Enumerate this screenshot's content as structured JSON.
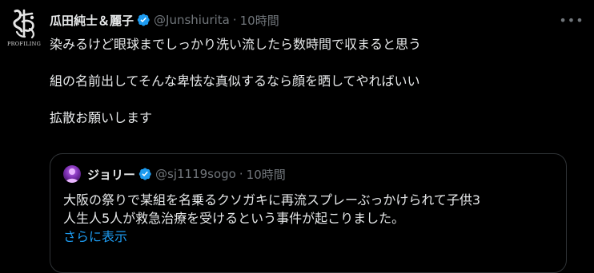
{
  "tweet": {
    "display_name": "瓜田純士＆麗子",
    "handle": "@Junshiurita",
    "separator": "·",
    "time": "10時間",
    "avatar_brand": "PROFILING",
    "lines": [
      "染みるけど眼球までしっかり洗い流したら数時間で収まると思う",
      "",
      "組の名前出してそんな卑怯な真似するなら顔を晒してやればいい",
      "",
      "拡散お願いします"
    ]
  },
  "quote": {
    "display_name": "ジョリー",
    "handle": "@sj1119sogo",
    "separator": "·",
    "time": "10時間",
    "text_lines": [
      "大阪の祭りで某組を名乗るクソガキに再流スプレーぶっかけられて子供3",
      "人生人5人が救急治療を受けるという事件が起こりました。"
    ],
    "show_more": "さらに表示"
  },
  "icons": {
    "verified": "verified-badge-icon",
    "more": "more-options-icon"
  },
  "colors": {
    "background": "#000000",
    "text": "#e7e9ea",
    "muted": "#71767b",
    "link": "#1d9bf0",
    "verified": "#1d9bf0",
    "border": "#2f3336"
  }
}
